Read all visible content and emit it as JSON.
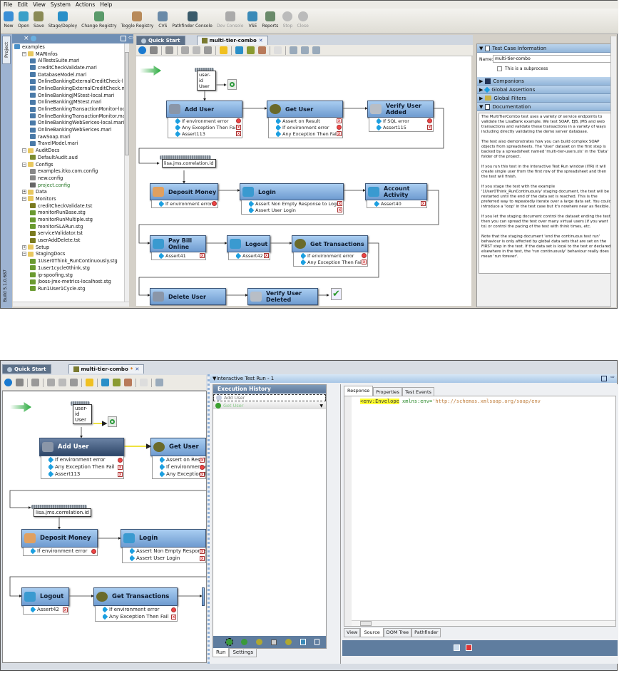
{
  "menu": [
    "File",
    "Edit",
    "View",
    "System",
    "Actions",
    "Help"
  ],
  "toolbar": [
    {
      "label": "New",
      "icon": "new-icon",
      "color": "#3a8fd6"
    },
    {
      "label": "Open",
      "icon": "open-icon",
      "color": "#3aa0c8"
    },
    {
      "label": "Save",
      "icon": "save-icon",
      "color": "#8a8a55"
    },
    {
      "label": "Stage/Deploy",
      "icon": "gear-icon",
      "color": "#2a8fc8"
    },
    {
      "label": "Change Registry",
      "icon": "registry-icon",
      "color": "#5a9a6a"
    },
    {
      "label": "Toggle Registry",
      "icon": "toggle-registry-icon",
      "color": "#b88a5a"
    },
    {
      "label": "CVS",
      "icon": "cvs-icon",
      "color": "#6a8aa8"
    },
    {
      "label": "Pathfinder Console",
      "icon": "pathfinder-icon",
      "color": "#3a5a6a"
    },
    {
      "label": "Dev Console",
      "icon": "dev-console-icon",
      "color": "#aaaaaa",
      "disabled": true
    },
    {
      "label": "VSE",
      "icon": "vse-icon",
      "color": "#3a8ab8"
    },
    {
      "label": "Reports",
      "icon": "reports-icon",
      "color": "#6a8a6a"
    },
    {
      "label": "Stop",
      "icon": "stop-icon",
      "color": "#bbbbbb",
      "disabled": true
    },
    {
      "label": "Close",
      "icon": "close-icon",
      "color": "#bbbbbb",
      "disabled": true
    }
  ],
  "left_panel": {
    "tab": "Project",
    "build": "Build 5.1.0.687",
    "tree": [
      {
        "label": "examples",
        "depth": 0,
        "type": "project"
      },
      {
        "label": "MARInfos",
        "depth": 1,
        "type": "folder"
      },
      {
        "label": "AllTestsSuite.mari",
        "depth": 2,
        "type": "mari"
      },
      {
        "label": "creditCheckValidate.mari",
        "depth": 2,
        "type": "mari"
      },
      {
        "label": "DatabaseModel.mari",
        "depth": 2,
        "type": "mari"
      },
      {
        "label": "OnlineBankingExternalCreditCheck-l",
        "depth": 2,
        "type": "mari"
      },
      {
        "label": "OnlineBankingExternalCreditCheck.m",
        "depth": 2,
        "type": "mari"
      },
      {
        "label": "OnlineBankingJMStest-local.mari",
        "depth": 2,
        "type": "mari"
      },
      {
        "label": "OnlineBankingJMStest.mari",
        "depth": 2,
        "type": "mari"
      },
      {
        "label": "OnlineBankingTransactionMonitor-loc",
        "depth": 2,
        "type": "mari"
      },
      {
        "label": "OnlineBankingTransactionMonitor.ma",
        "depth": 2,
        "type": "mari"
      },
      {
        "label": "OnlineBankingWebSerices-local.mari",
        "depth": 2,
        "type": "mari"
      },
      {
        "label": "OnlineBankingWebSerices.mari",
        "depth": 2,
        "type": "mari"
      },
      {
        "label": "rawSoap.mari",
        "depth": 2,
        "type": "mari"
      },
      {
        "label": "TravelModel.mari",
        "depth": 2,
        "type": "mari"
      },
      {
        "label": "AuditDocs",
        "depth": 1,
        "type": "folder"
      },
      {
        "label": "DefaultAudit.aud",
        "depth": 2,
        "type": "aud"
      },
      {
        "label": "Configs",
        "depth": 1,
        "type": "folder"
      },
      {
        "label": "examples.itko.com.config",
        "depth": 2,
        "type": "config"
      },
      {
        "label": "new.config",
        "depth": 2,
        "type": "config"
      },
      {
        "label": "project.config",
        "depth": 2,
        "type": "config-active"
      },
      {
        "label": "Data",
        "depth": 1,
        "type": "folder"
      },
      {
        "label": "Monitors",
        "depth": 1,
        "type": "folder"
      },
      {
        "label": "creditCheckValidate.tst",
        "depth": 2,
        "type": "tst"
      },
      {
        "label": "monitorRunBase.stg",
        "depth": 2,
        "type": "stg"
      },
      {
        "label": "monitorRunMultiple.stg",
        "depth": 2,
        "type": "stg"
      },
      {
        "label": "monitorSLARun.stg",
        "depth": 2,
        "type": "stg"
      },
      {
        "label": "serviceValidator.tst",
        "depth": 2,
        "type": "tst"
      },
      {
        "label": "userAddDelete.tst",
        "depth": 2,
        "type": "tst"
      },
      {
        "label": "Setup",
        "depth": 1,
        "type": "folder"
      },
      {
        "label": "StagingDocs",
        "depth": 1,
        "type": "folder"
      },
      {
        "label": "1User0Think_RunContinuously.stg",
        "depth": 2,
        "type": "stg"
      },
      {
        "label": "1user1cycle0think.stg",
        "depth": 2,
        "type": "stg"
      },
      {
        "label": "ip-spoofing.stg",
        "depth": 2,
        "type": "stg"
      },
      {
        "label": "jboss-jmx-metrics-localhost.stg",
        "depth": 2,
        "type": "stg"
      },
      {
        "label": "Run1User1Cycle.stg",
        "depth": 2,
        "type": "stg"
      }
    ]
  },
  "tabs": {
    "quick_start": "Quick Start",
    "editor": "multi-tier-combo",
    "modified_mark": "*"
  },
  "datasets": {
    "user": [
      "user-id",
      "User"
    ],
    "correlation": "lisa.jms.correlation.id"
  },
  "steps": [
    {
      "name": "Add User",
      "icon": "ejb-icon",
      "assertions": [
        {
          "label": "If environment error",
          "kind": "stop"
        },
        {
          "label": "Any Exception Then Fail",
          "kind": "fail"
        },
        {
          "label": "Assert113",
          "kind": "fail"
        }
      ]
    },
    {
      "name": "Get User",
      "icon": "bean-icon",
      "assertions": [
        {
          "label": "Assert on Result",
          "kind": "fail"
        },
        {
          "label": "If environment error",
          "kind": "stop"
        },
        {
          "label": "Any Exception Then Fail",
          "kind": "fail"
        }
      ]
    },
    {
      "name": "Verify User Added",
      "icon": "database-icon",
      "assertions": [
        {
          "label": "If SQL error",
          "kind": "stop"
        },
        {
          "label": "Assert115",
          "kind": "fail"
        }
      ]
    },
    {
      "name": "Deposit Money",
      "icon": "jms-icon",
      "assertions": [
        {
          "label": "If environment error",
          "kind": "stop"
        }
      ]
    },
    {
      "name": "Login",
      "icon": "web-service-icon",
      "assertions": [
        {
          "label": "Assert Non Empty Response to Login",
          "kind": "fail"
        },
        {
          "label": "Assert User Login",
          "kind": "fail"
        }
      ]
    },
    {
      "name": "Account Activity",
      "icon": "web-service-icon",
      "assertions": [
        {
          "label": "Assert40",
          "kind": "fail"
        }
      ]
    },
    {
      "name": "Pay Bill Online",
      "icon": "web-service-icon",
      "assertions": [
        {
          "label": "Assert41",
          "kind": "fail"
        }
      ]
    },
    {
      "name": "Logout",
      "icon": "web-service-icon",
      "assertions": [
        {
          "label": "Assert42",
          "kind": "fail"
        }
      ]
    },
    {
      "name": "Get Transactions",
      "icon": "bean-icon",
      "assertions": [
        {
          "label": "If environment error",
          "kind": "stop"
        },
        {
          "label": "Any Exception Then Fail",
          "kind": "fail"
        }
      ]
    },
    {
      "name": "Delete User",
      "icon": "ejb-icon",
      "assertions": []
    },
    {
      "name": "Verify User Deleted",
      "icon": "database-icon",
      "assertions": []
    }
  ],
  "right_panel": {
    "test_case_info": "Test Case Information",
    "name_label": "Name:",
    "name_value": "multi-tier-combo",
    "subprocess_label": "This is a subprocess",
    "subprocess_checked": false,
    "companions": "Companions",
    "global_assertions": "Global Assertions",
    "global_filters": "Global Filters",
    "documentation": "Documentation",
    "doc_paragraphs": [
      "The MultiTierCombo test uses a variety of service endpoints to validate the LisaBank example. We test SOAP, EJB, JMS and web transactions and validate these transactions in a variety of ways including directly validating the demo server database.",
      "The test also demonstrates how you can build complex SOAP objects from spreadsheets. The 'User' dataset on the first step is backed by a spreadsheet named 'multi-tier-users.xls' in the 'Data' folder of the project.",
      "If you run this test in the Interactive Test Run window (ITR) it will create single user from the first row of the spreadsheet and then the test will finish.",
      "If you stage the test with the example '1User0Think_RunContinuously' staging document, the test will be restarted until the end of the data set is reached. This is the preferred way to repeatedly iterate over a large data set. You could introduce a 'loop' in the test case but it's nowhere near as flexible.",
      " If you let the staging document control the dataset ending the test then you can spread the test over many virtual users (if you want to) or control the pacing of the test with think times, etc.",
      "Note that the staging document 'end the continuous test run' behaviour is only affected by global data sets that are set on the FIRST step in the test. If the data set is local to the test or declared elsewhere in the test, the 'run continuously' behaviour really does mean 'run forever'."
    ]
  },
  "itr": {
    "title": "Interactive Test Run - 1",
    "history_title": "Execution History",
    "history": [
      {
        "label": "Add User",
        "status": "pending"
      },
      {
        "label": "Get User",
        "status": "ok"
      }
    ],
    "response_tabs": [
      "Response",
      "Properties",
      "Test Events"
    ],
    "code": {
      "tag": "<env:Envelope",
      "attr": "xmlns:env=",
      "value": "'http://schemas.xmlsoap.org/soap/env"
    },
    "view_tabs": [
      "View",
      "Source",
      "DOM Tree",
      "Pathfinder"
    ],
    "run_tabs": [
      "Run",
      "Settings"
    ]
  }
}
